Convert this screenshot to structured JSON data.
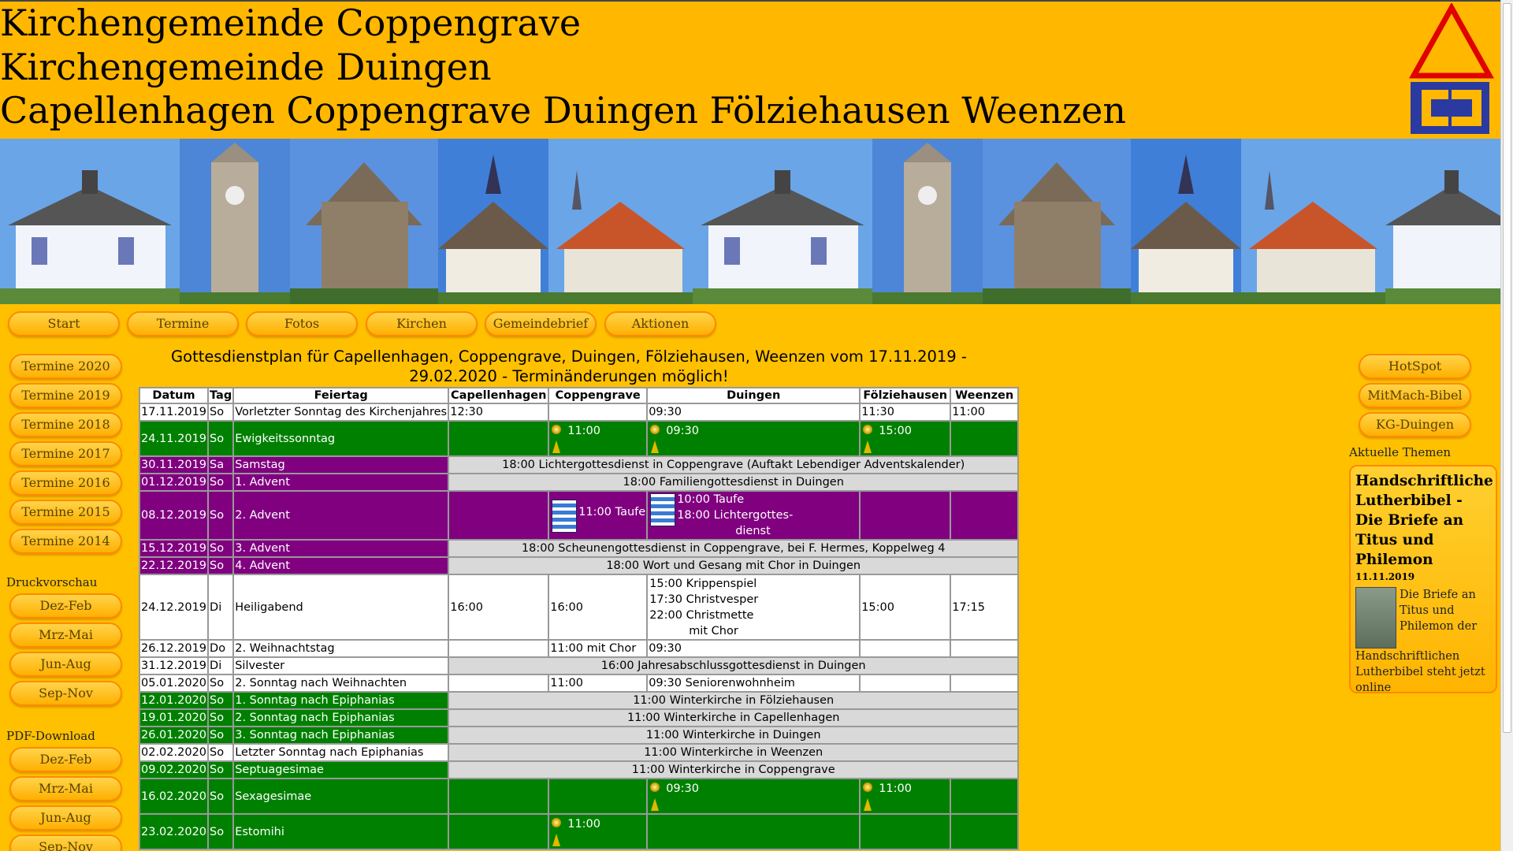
{
  "header": {
    "line1": "Kirchengemeinde Coppengrave",
    "line2": "Kirchengemeinde Duingen",
    "line3": "Capellenhagen Coppengrave Duingen Fölziehausen Weenzen"
  },
  "nav": {
    "items": [
      "Start",
      "Termine",
      "Fotos",
      "Kirchen",
      "Gemeindebrief",
      "Aktionen"
    ]
  },
  "left": {
    "termine": [
      "Termine 2020",
      "Termine 2019",
      "Termine 2018",
      "Termine 2017",
      "Termine 2016",
      "Termine 2015",
      "Termine 2014"
    ],
    "druck_label": "Druckvorschau",
    "druck": [
      "Dez-Feb",
      "Mrz-Mai",
      "Jun-Aug",
      "Sep-Nov"
    ],
    "pdf_label": "PDF-Download",
    "pdf": [
      "Dez-Feb",
      "Mrz-Mai",
      "Jun-Aug",
      "Sep-Nov"
    ]
  },
  "plan": {
    "title": "Gottesdienstplan für Capellenhagen, Coppengrave, Duingen, Fölziehausen, Weenzen vom 17.11.2019 - 29.02.2020 - Terminänderungen möglich!",
    "headers": [
      "Datum",
      "Tag",
      "Feiertag",
      "Capellenhagen",
      "Coppengrave",
      "Duingen",
      "Fölziehausen",
      "Weenzen"
    ],
    "rows": [
      {
        "datum": "17.11.2019",
        "tag": "So",
        "feiertag": "Vorletzter Sonntag des Kirchenjahres",
        "cap": "12:30",
        "cop": "",
        "dui": "09:30",
        "fol": "11:30",
        "wee": "11:00"
      },
      {
        "datum": "24.11.2019",
        "tag": "So",
        "feiertag": "Ewigkeitssonntag",
        "cop": "11:00",
        "dui": "09:30",
        "fol": "15:00"
      },
      {
        "datum": "30.11.2019",
        "tag": "Sa",
        "feiertag": "Samstag",
        "msg": "18:00 Lichtergottesdienst in Coppengrave (Auftakt Lebendiger Adventskalender)"
      },
      {
        "datum": "01.12.2019",
        "tag": "So",
        "feiertag": "1. Advent",
        "msg": "18:00 Familiengottesdienst in Duingen"
      },
      {
        "datum": "08.12.2019",
        "tag": "So",
        "feiertag": "2. Advent",
        "cop": "11:00 Taufe",
        "dui1": "10:00 Taufe",
        "dui2": "18:00 Lichtergottes-",
        "dui3": "dienst"
      },
      {
        "datum": "15.12.2019",
        "tag": "So",
        "feiertag": "3. Advent",
        "msg": "18:00 Scheunengottesdienst in Coppengrave, bei F. Hermes, Koppelweg 4"
      },
      {
        "datum": "22.12.2019",
        "tag": "So",
        "feiertag": "4. Advent",
        "msg": "18:00 Wort und Gesang mit Chor in Duingen"
      },
      {
        "datum": "24.12.2019",
        "tag": "Di",
        "feiertag": "Heiligabend",
        "cap": "16:00",
        "cop": "16:00",
        "dui1": "15:00 Krippenspiel",
        "dui2": "17:30 Christvesper",
        "dui3": "22:00 Christmette",
        "dui4": "mit Chor",
        "fol": "15:00",
        "wee": "17:15"
      },
      {
        "datum": "26.12.2019",
        "tag": "Do",
        "feiertag": "2. Weihnachtstag",
        "cop": "11:00 mit Chor",
        "dui": "09:30"
      },
      {
        "datum": "31.12.2019",
        "tag": "Di",
        "feiertag": "Silvester",
        "msg": "16:00 Jahresabschlussgottesdienst in Duingen"
      },
      {
        "datum": "05.01.2020",
        "tag": "So",
        "feiertag": "2. Sonntag nach Weihnachten",
        "cop": "11:00",
        "dui": "09:30 Seniorenwohnheim"
      },
      {
        "datum": "12.01.2020",
        "tag": "So",
        "feiertag": "1. Sonntag nach Epiphanias",
        "msg": "11:00 Winterkirche in Fölziehausen"
      },
      {
        "datum": "19.01.2020",
        "tag": "So",
        "feiertag": "2. Sonntag nach Epiphanias",
        "msg": "11:00 Winterkirche in Capellenhagen"
      },
      {
        "datum": "26.01.2020",
        "tag": "So",
        "feiertag": "3. Sonntag nach Epiphanias",
        "msg": "11:00 Winterkirche in Duingen"
      },
      {
        "datum": "02.02.2020",
        "tag": "So",
        "feiertag": "Letzter Sonntag nach Epiphanias",
        "msg": "11:00 Winterkirche in Weenzen"
      },
      {
        "datum": "09.02.2020",
        "tag": "So",
        "feiertag": "Septuagesimae",
        "msg": "11:00 Winterkirche in Coppengrave"
      },
      {
        "datum": "16.02.2020",
        "tag": "So",
        "feiertag": "Sexagesimae",
        "dui": "09:30",
        "fol": "11:00"
      },
      {
        "datum": "23.02.2020",
        "tag": "So",
        "feiertag": "Estomihi",
        "cop": "11:00"
      }
    ]
  },
  "right": {
    "buttons": [
      "HotSpot",
      "MitMach-Bibel",
      "KG-Duingen"
    ],
    "themen_label": "Aktuelle Themen",
    "article_title": "Handschriftliche Lutherbibel - Die Briefe an Titus und Philemon",
    "article_date": "11.11.2019",
    "article_text": "Die Briefe an Titus und Philemon der Handschriftlichen Lutherbibel steht jetzt online"
  },
  "colors": {
    "page": "#ffc000",
    "green_row": "#008000",
    "purple_row": "#800080",
    "message_cell": "#d9d9d9"
  }
}
